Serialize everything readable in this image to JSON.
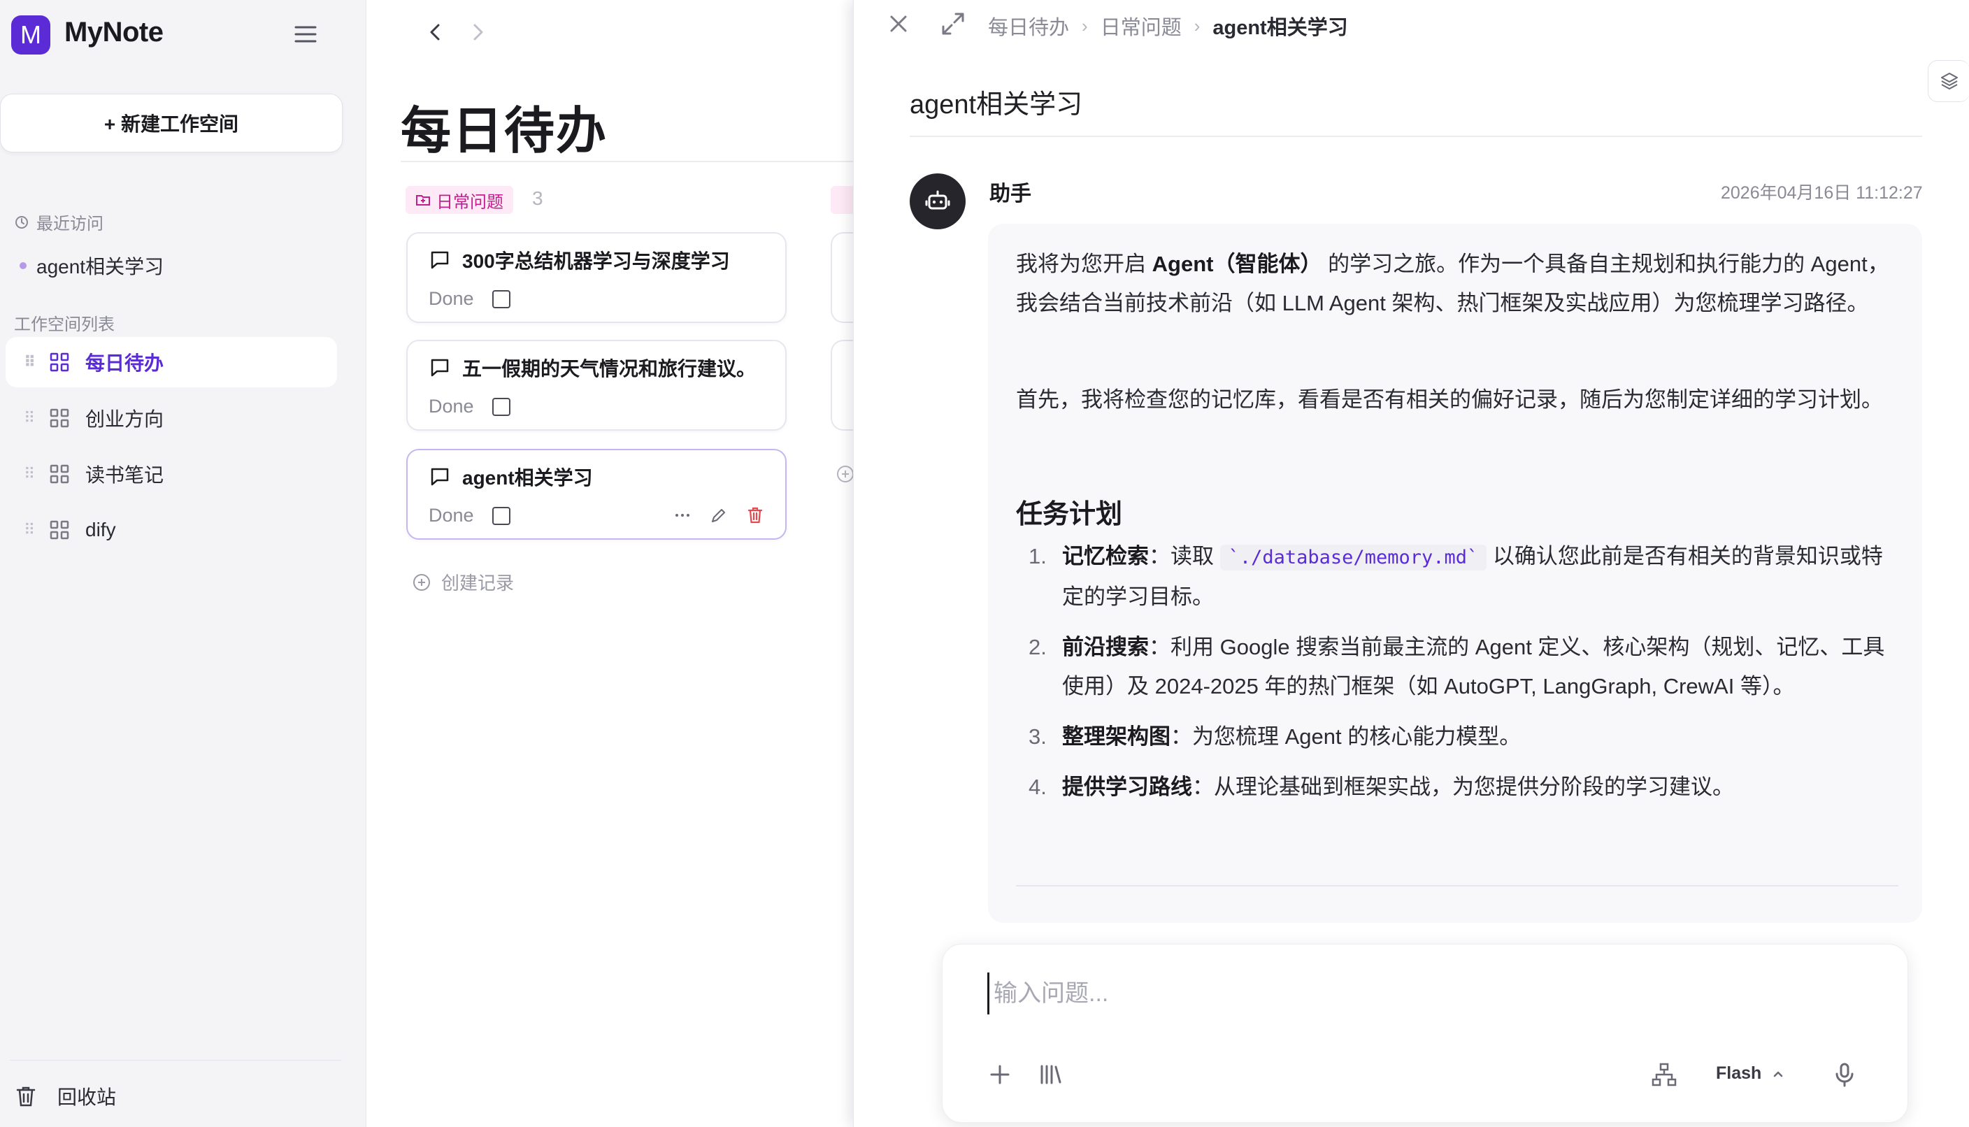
{
  "app": {
    "logo_letter": "M",
    "name": "MyNote"
  },
  "sidebar": {
    "new_workspace": "+ 新建工作空间",
    "recent_label": "最近访问",
    "recent_items": [
      "agent相关学习"
    ],
    "workspace_label": "工作空间列表",
    "workspaces": [
      {
        "label": "每日待办",
        "active": true
      },
      {
        "label": "创业方向",
        "active": false
      },
      {
        "label": "读书笔记",
        "active": false
      },
      {
        "label": "dify",
        "active": false
      }
    ],
    "trash": "回收站"
  },
  "board": {
    "title": "每日待办",
    "group": {
      "name": "日常问题",
      "count": "3"
    },
    "cards": [
      {
        "title": "300字总结机器学习与深度学习",
        "status": "Done"
      },
      {
        "title": "五一假期的天气情况和旅行建议。",
        "status": "Done"
      },
      {
        "title": "agent相关学习",
        "status": "Done"
      }
    ],
    "create_record": "创建记录"
  },
  "panel": {
    "breadcrumb": [
      "每日待办",
      "日常问题",
      "agent相关学习"
    ],
    "doc_title": "agent相关学习",
    "message": {
      "sender": "助手",
      "timestamp": "2026年04月16日 11:12:27",
      "p1_a": "我将为您开启 ",
      "p1_b": "Agent（智能体）",
      "p1_c": " 的学习之旅。作为一个具备自主规划和执行能力的 Agent，我会结合当前技术前沿（如 LLM Agent 架构、热门框架及实战应用）为您梳理学习路径。",
      "p2": "首先，我将检查您的记忆库，看看是否有相关的偏好记录，随后为您制定详细的学习计划。",
      "heading": "任务计划",
      "steps": [
        {
          "num": "1.",
          "title": "记忆检索",
          "pre": "：读取 ",
          "code": "`./database/memory.md`",
          "post": " 以确认您此前是否有相关的背景知识或特定的学习目标。"
        },
        {
          "num": "2.",
          "title": "前沿搜索",
          "pre": "：利用 Google 搜索当前最主流的 Agent 定义、核心架构（规划、记忆、工具使用）及 2024-2025 年的热门框架（如 AutoGPT, LangGraph, CrewAI 等）。",
          "code": "",
          "post": ""
        },
        {
          "num": "3.",
          "title": "整理架构图",
          "pre": "：为您梳理 Agent 的核心能力模型。",
          "code": "",
          "post": ""
        },
        {
          "num": "4.",
          "title": "提供学习路线",
          "pre": "：从理论基础到框架实战，为您提供分阶段的学习建议。",
          "code": "",
          "post": ""
        }
      ]
    },
    "composer": {
      "placeholder": "输入问题...",
      "model": "Flash"
    }
  },
  "colors": {
    "accent": "#5b2bd6",
    "tag_bg": "#fdeaf6",
    "tag_text": "#c21f8e",
    "delete": "#e5484d"
  },
  "icons": [
    "menu-icon",
    "chevron-left-icon",
    "chevron-right-icon",
    "close-icon",
    "expand-icon",
    "layers-icon",
    "bot-icon",
    "comment-icon",
    "more-icon",
    "edit-icon",
    "delete-icon",
    "plus-circle-icon",
    "history-icon",
    "grid-icon",
    "trash-icon",
    "plus-icon",
    "library-icon",
    "sitemap-icon",
    "chevron-up-icon",
    "mic-icon"
  ]
}
